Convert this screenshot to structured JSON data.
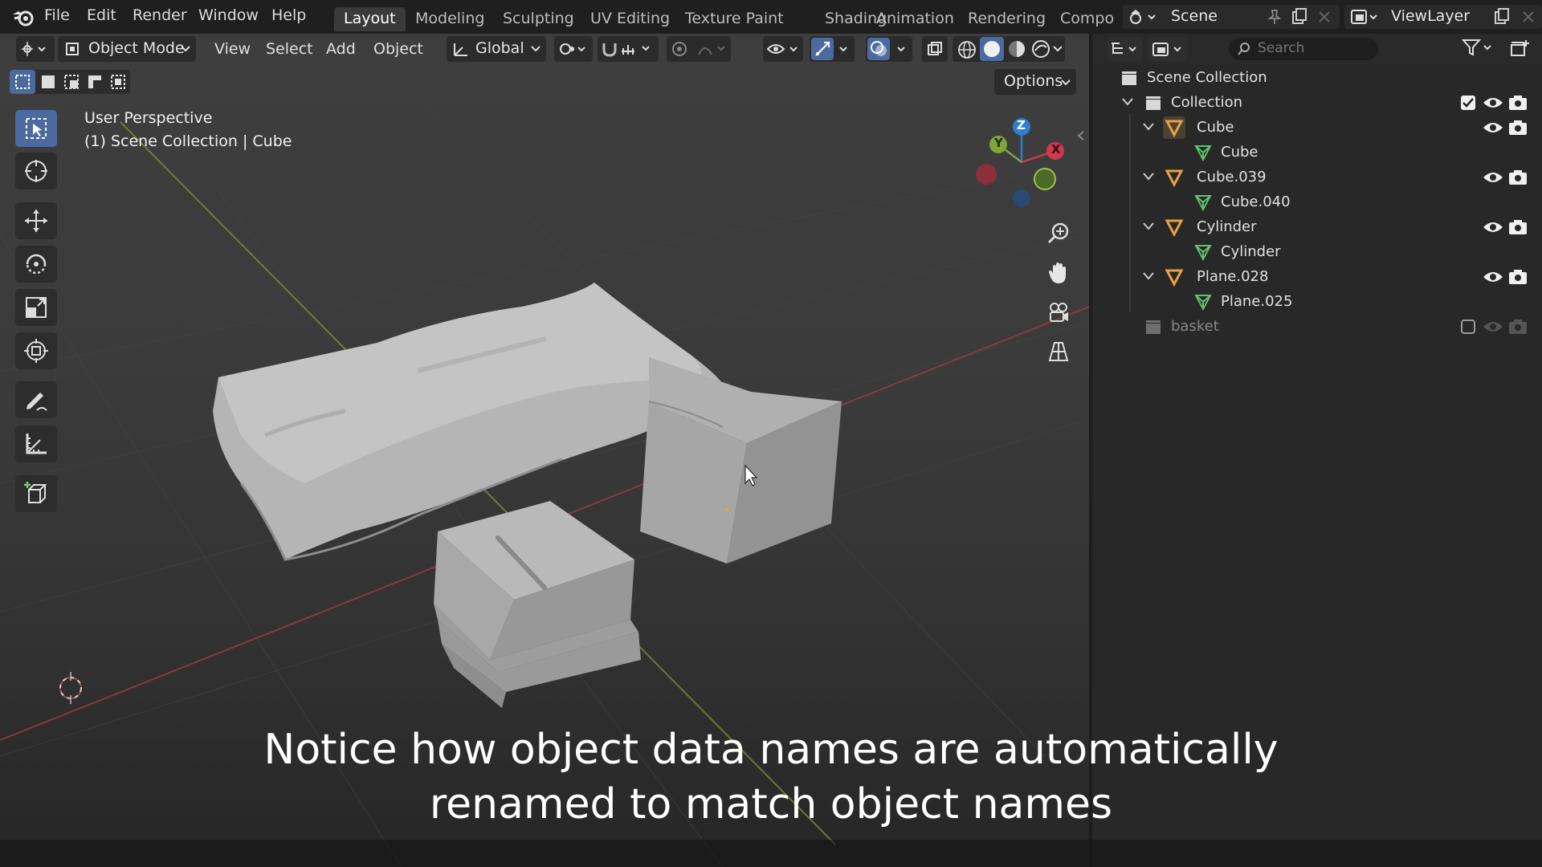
{
  "menubar": {
    "items": [
      "File",
      "Edit",
      "Render",
      "Window",
      "Help"
    ]
  },
  "workspaces": [
    "Layout",
    "Modeling",
    "Sculpting",
    "UV Editing",
    "Texture Paint",
    "Shading",
    "Animation",
    "Rendering",
    "Compo"
  ],
  "scene": {
    "label": "Scene"
  },
  "view_layer": {
    "label": "ViewLayer"
  },
  "viewport_header": {
    "mode": "Object Mode",
    "menus": [
      "View",
      "Select",
      "Add",
      "Object"
    ],
    "orientation": "Global",
    "options_label": "Options"
  },
  "viewport_info": {
    "line1": "User Perspective",
    "line2": "(1) Scene Collection | Cube"
  },
  "gizmo": {
    "x": "X",
    "y": "Y",
    "z": "Z"
  },
  "outliner": {
    "search_placeholder": "Search",
    "scene_collection": "Scene Collection",
    "collection": "Collection",
    "objects": [
      {
        "name": "Cube",
        "data": "Cube"
      },
      {
        "name": "Cube.039",
        "data": "Cube.040"
      },
      {
        "name": "Cylinder",
        "data": "Cylinder"
      },
      {
        "name": "Plane.028",
        "data": "Plane.025"
      }
    ],
    "basket": "basket"
  },
  "subtitle": {
    "line1": "Notice how object data names are automatically",
    "line2": "renamed to match object names"
  },
  "colors": {
    "accent": "#4a6aa0",
    "object_orange": "#e8a144",
    "mesh_green": "#5fc26b",
    "axis_x": "#d0384b",
    "axis_y": "#7ea73a",
    "axis_z": "#2e7fd0"
  }
}
